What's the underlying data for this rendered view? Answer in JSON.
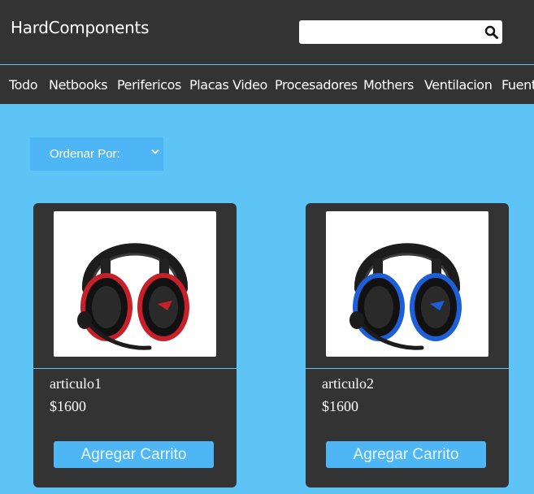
{
  "header": {
    "brand": "HardComponents",
    "search": {
      "value": "",
      "placeholder": ""
    }
  },
  "nav": {
    "items": [
      {
        "label": "Todo"
      },
      {
        "label": "Netbooks"
      },
      {
        "label": "Perifericos"
      },
      {
        "label": "Placas Video"
      },
      {
        "label": "Procesadores"
      },
      {
        "label": "Mothers"
      },
      {
        "label": "Ventilacion"
      },
      {
        "label": "Fuent"
      }
    ]
  },
  "sort": {
    "label": "Ordenar Por:"
  },
  "products": [
    {
      "name": "articulo1",
      "price": "$1600",
      "button": "Agregar Carrito",
      "accent": "#c8202a",
      "image_icon": "headset-icon"
    },
    {
      "name": "articulo2",
      "price": "$1600",
      "button": "Agregar Carrito",
      "accent": "#1d5fd6",
      "image_icon": "headset-icon"
    }
  ],
  "colors": {
    "bar": "#333333",
    "page": "#5ec4f6",
    "button": "#4fb6f5"
  }
}
